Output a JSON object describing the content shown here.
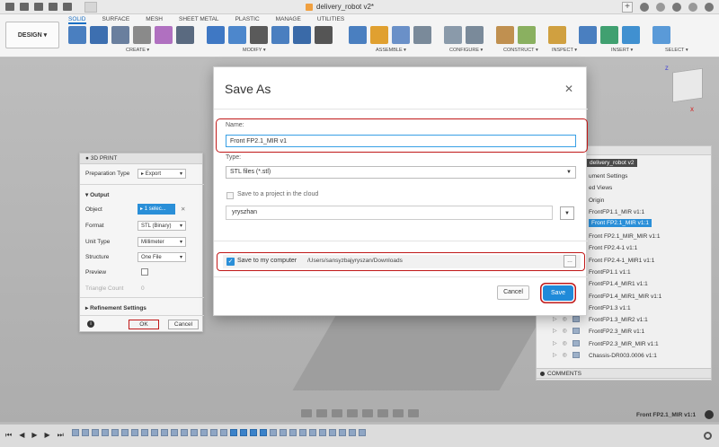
{
  "titlebar": {
    "doc_title": "delivery_robot v2*"
  },
  "ribbon": {
    "design_label": "DESIGN ▾",
    "tabs": [
      "SOLID",
      "SURFACE",
      "MESH",
      "SHEET METAL",
      "PLASTIC",
      "MANAGE",
      "UTILITIES"
    ],
    "active_tab": "SOLID",
    "groups": [
      "CREATE ▾",
      "MODIFY ▾",
      "ASSEMBLE ▾",
      "CONFIGURE ▾",
      "CONSTRUCT ▾",
      "INSPECT ▾",
      "INSERT ▾",
      "SELECT ▾"
    ]
  },
  "viewcube": {
    "z": "Z",
    "x": "X"
  },
  "print_panel": {
    "title": "3D PRINT",
    "prep_type_label": "Preparation Type",
    "prep_type_value": "Export",
    "output_section": "Output",
    "object_label": "Object",
    "object_value": "1 selec...",
    "format_label": "Format",
    "format_value": "STL (Binary)",
    "unit_label": "Unit Type",
    "unit_value": "Millimeter",
    "structure_label": "Structure",
    "structure_value": "One File",
    "preview_label": "Preview",
    "triangle_label": "Triangle Count",
    "triangle_value": "0",
    "refinement_label": "Refinement Settings",
    "ok_label": "OK",
    "cancel_label": "Cancel"
  },
  "dialog": {
    "title": "Save As",
    "name_label": "Name:",
    "name_value": "Front FP2.1_MIR v1",
    "type_label": "Type:",
    "type_value": "STL files (*.stl)",
    "cloud_label": "Save to a project in the cloud",
    "project_value": "yryszhan",
    "computer_label": "Save to my computer",
    "computer_path": "/Users/sansyzbajyryszan/Downloads",
    "cancel_label": "Cancel",
    "save_label": "Save"
  },
  "browser": {
    "root": "delivery_robot v2",
    "items": [
      "ument Settings",
      "ed Views",
      "Origin",
      "FrontFP1.1_MIR v1:1",
      "Front FP2.1_MIR v1:1",
      "Front FP2.1_MIR_MIR v1:1",
      "Front FP2.4-1 v1:1",
      "Front FP2.4-1_MIR1 v1:1",
      "FrontFP1.1 v1:1",
      "FrontFP1.4_MIR1 v1:1",
      "FrontFP1.4_MIR1_MIR v1:1",
      "FrontFP1.3 v1:1",
      "FrontFP1.3_MIR2 v1:1",
      "FrontFP2.3_MIR v1:1",
      "FrontFP2.3_MIR_MIR v1:1",
      "Chassis-DR003.0006 v1:1"
    ],
    "highlighted": "Front FP2.1_MIR v1:1",
    "comments": "COMMENTS"
  },
  "status": {
    "bottom_label": "Front FP2.1_MIR v1:1"
  },
  "colors": {
    "accent": "#1f8ad9",
    "highlight_red": "#c01818"
  }
}
